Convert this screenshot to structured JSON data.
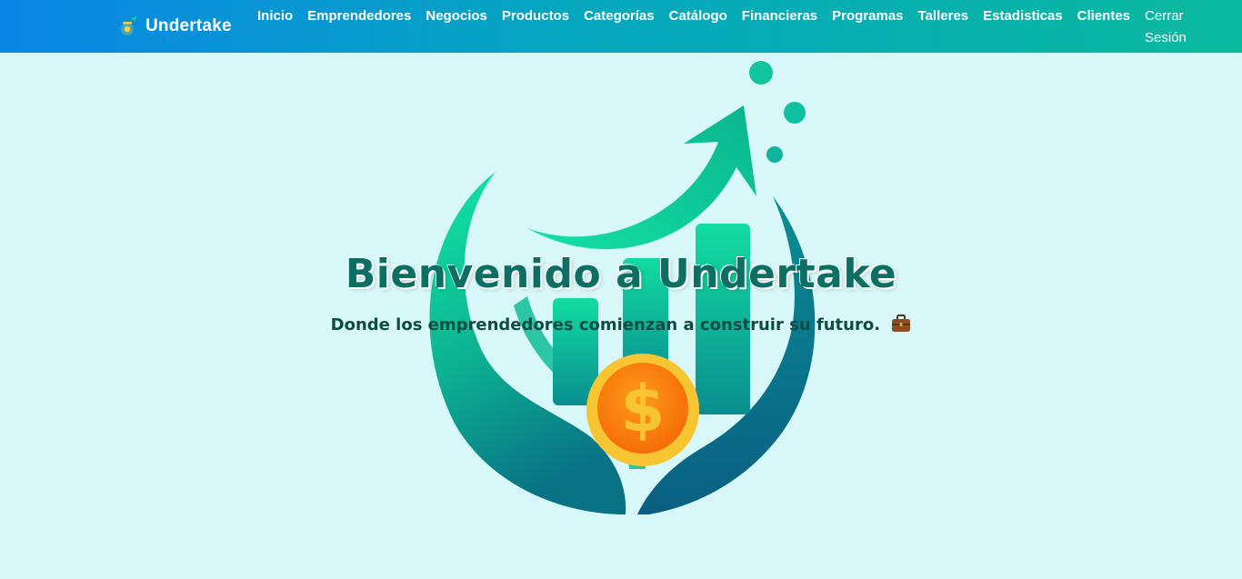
{
  "navbar": {
    "brand_icon": "money-bag-icon",
    "brand_name": "Undertake",
    "links": [
      {
        "label": "Inicio"
      },
      {
        "label": "Emprendedores"
      },
      {
        "label": "Negocios"
      },
      {
        "label": "Productos"
      },
      {
        "label": "Categorías"
      },
      {
        "label": "Catálogo"
      },
      {
        "label": "Financieras"
      },
      {
        "label": "Programas"
      },
      {
        "label": "Talleres"
      },
      {
        "label": "Estadisticas"
      },
      {
        "label": "Clientes"
      }
    ],
    "logout_label": "Cerrar Sesión"
  },
  "hero": {
    "title": "Bienvenido a Undertake",
    "subtitle": "Donde los emprendedores comienzan a construir su futuro.",
    "subtitle_icon": "briefcase-icon",
    "art": "growth-logo-illustration",
    "coin_symbol": "$"
  },
  "colors": {
    "background": "#d8f7f8",
    "nav_gradient_start": "#0a86e6",
    "nav_gradient_end": "#0ab99e",
    "title": "#0d6e63",
    "subtitle": "#0c4c44",
    "logo_green": "#10d49a",
    "logo_teal": "#0a6f86",
    "coin_gold": "#f7c532",
    "coin_orange": "#f7790a"
  }
}
